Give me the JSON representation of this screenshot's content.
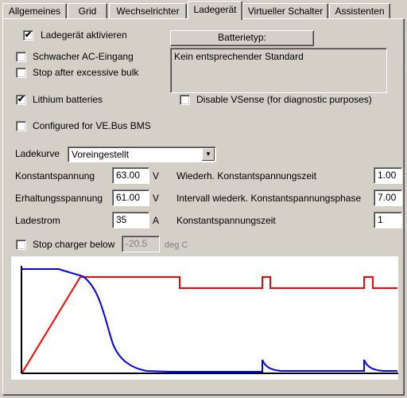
{
  "tabs": [
    {
      "label": "Allgemeines",
      "active": false
    },
    {
      "label": "Grid",
      "active": false
    },
    {
      "label": "Wechselrichter",
      "active": false
    },
    {
      "label": "Ladegerät",
      "active": true
    },
    {
      "label": "Virtueller Schalter",
      "active": false
    },
    {
      "label": "Assistenten",
      "active": false
    }
  ],
  "options": {
    "enable_charger": {
      "label": "Ladegerät aktivieren",
      "checked": true
    },
    "weak_ac": {
      "label": "Schwacher AC-Eingang",
      "checked": false
    },
    "stop_bulk": {
      "label": "Stop after excessive bulk",
      "checked": false
    },
    "lithium": {
      "label": "Lithium batteries",
      "checked": true
    },
    "disable_vsense": {
      "label": "Disable VSense (for diagnostic purposes)",
      "checked": false
    },
    "vebus_bms": {
      "label": "Configured for VE.Bus BMS",
      "checked": false
    }
  },
  "battery_type": {
    "button_label": "Batterietyp:",
    "description": "Kein entsprechender Standard"
  },
  "charge_curve": {
    "label": "Ladekurve",
    "selected": "Voreingestellt"
  },
  "left_params": [
    {
      "label": "Konstantspannung",
      "value": "63.00",
      "unit": "V"
    },
    {
      "label": "Erhaltungsspannung",
      "value": "61.00",
      "unit": "V"
    },
    {
      "label": "Ladestrom",
      "value": "35",
      "unit": "A"
    }
  ],
  "right_params": [
    {
      "label": "Wiederh. Konstantspannungszeit",
      "value": "1.00"
    },
    {
      "label": "Intervall wiederk. Konstantspannungsphase",
      "value": "7.00"
    },
    {
      "label": "Konstantspannungszeit",
      "value": "1"
    }
  ],
  "stop_below": {
    "label": "Stop charger below",
    "value": "-20.5",
    "unit": "deg C",
    "checked": false
  },
  "colors": {
    "voltage_curve": "#ff0000",
    "current_curve": "#0000ff",
    "axes": "#000000"
  }
}
